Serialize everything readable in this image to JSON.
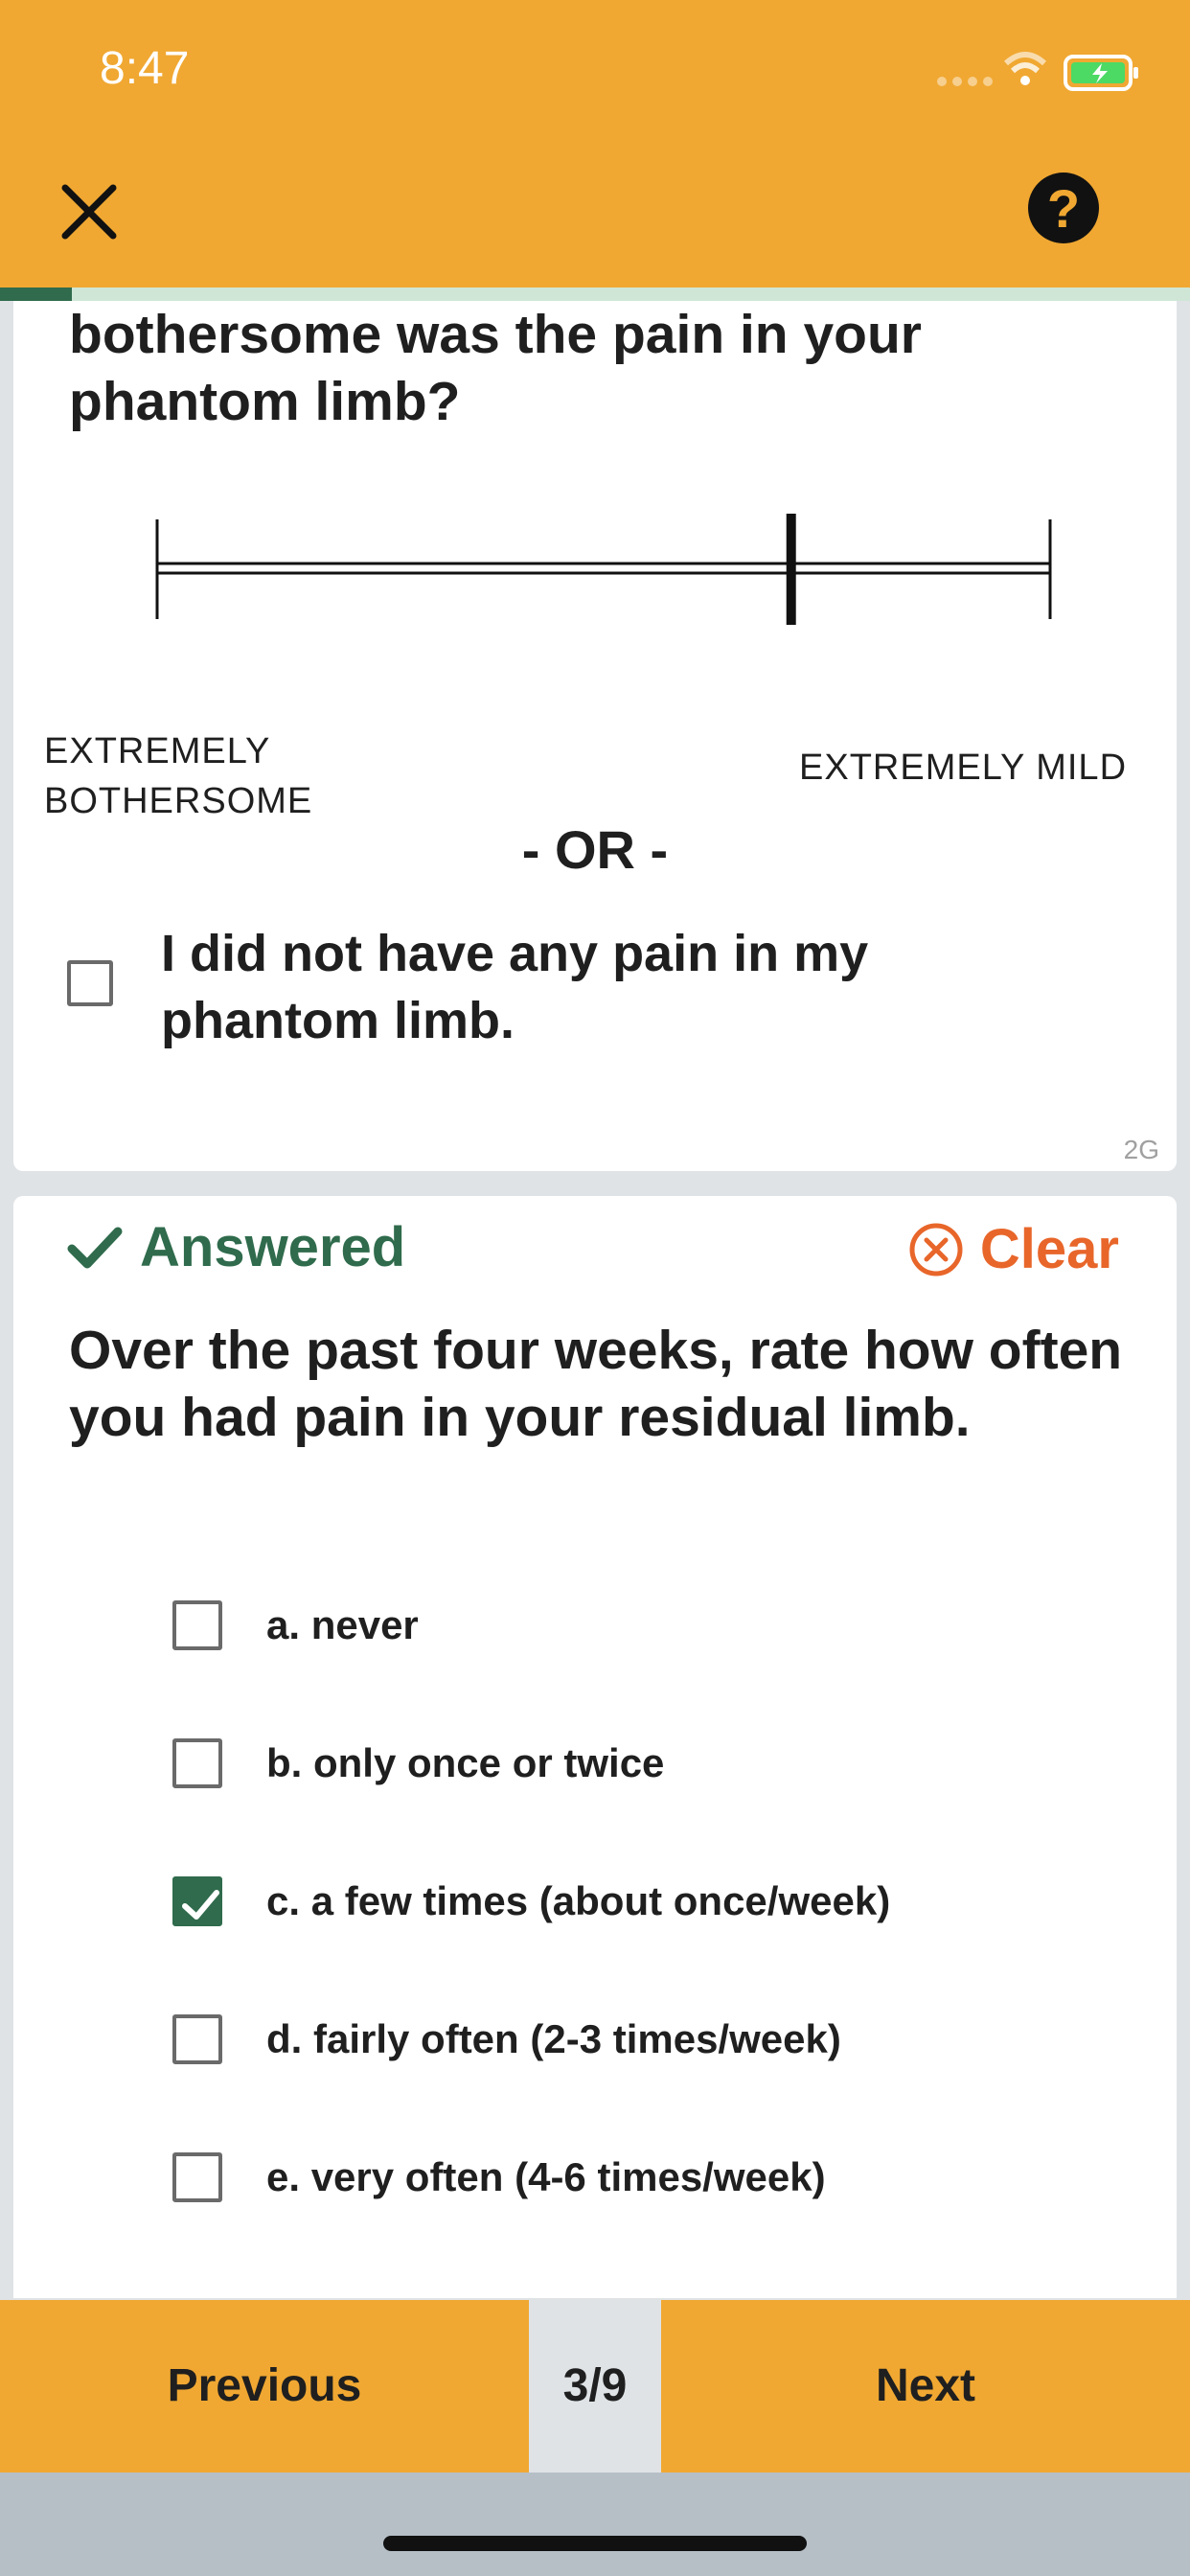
{
  "status_bar": {
    "time": "8:47"
  },
  "app_bar": {
    "close_icon": "close-icon",
    "help_label": "?"
  },
  "progress": {
    "fraction": 0.06,
    "fill_color": "#2f6b4c",
    "track_color": "#cfe6d6"
  },
  "question_1": {
    "text": "bothersome was the pain in your phantom limb?",
    "scale_left_label": "EXTREMELY BOTHERSOME",
    "scale_right_label": "EXTREMELY MILD",
    "scale_value_fraction": 0.71,
    "or_label": "- OR -",
    "no_pain_label": "I did not have any pain in my phantom limb.",
    "no_pain_checked": false,
    "item_id": "2G"
  },
  "question_2": {
    "status_label": "Answered",
    "clear_label": "Clear",
    "text": "Over the past four weeks, rate how often you had pain in your residual limb.",
    "options": [
      {
        "label": "a. never",
        "checked": false
      },
      {
        "label": "b. only once or twice",
        "checked": false
      },
      {
        "label": "c. a few times (about once/week)",
        "checked": true
      },
      {
        "label": "d. fairly often (2-3 times/week)",
        "checked": false
      },
      {
        "label": "e. very often (4-6 times/week)",
        "checked": false
      }
    ]
  },
  "navigation": {
    "previous_label": "Previous",
    "page_indicator": "3/9",
    "next_label": "Next"
  },
  "colors": {
    "accent": "#f0a832",
    "answered": "#2f6b4c",
    "clear": "#e8662a"
  }
}
